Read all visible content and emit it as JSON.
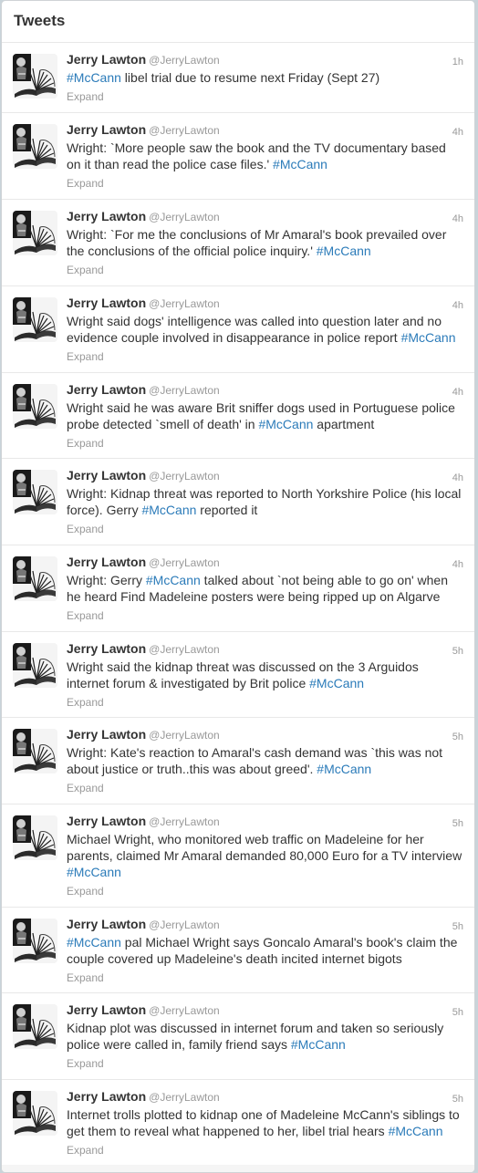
{
  "header": {
    "title": "Tweets"
  },
  "expand_label": "Expand",
  "colors": {
    "hashtag": "#2b7bb9",
    "name": "#333333",
    "meta": "#999999"
  },
  "tweets": [
    {
      "name": "Jerry Lawton",
      "handle": "@JerryLawton",
      "time": "1h",
      "segments": [
        {
          "tag": "#McCann"
        },
        {
          "t": " libel trial due to resume next Friday (Sept 27)"
        }
      ]
    },
    {
      "name": "Jerry Lawton",
      "handle": "@JerryLawton",
      "time": "4h",
      "segments": [
        {
          "t": "Wright: `More people saw the book and the TV documentary based on it than read the police case files.' "
        },
        {
          "tag": "#McCann"
        }
      ]
    },
    {
      "name": "Jerry Lawton",
      "handle": "@JerryLawton",
      "time": "4h",
      "segments": [
        {
          "t": "Wright: `For me the conclusions of Mr Amaral's book prevailed over the conclusions of the official police inquiry.' "
        },
        {
          "tag": "#McCann"
        }
      ]
    },
    {
      "name": "Jerry Lawton",
      "handle": "@JerryLawton",
      "time": "4h",
      "segments": [
        {
          "t": "Wright said dogs' intelligence was called into question later and no evidence couple involved in disappearance in police report "
        },
        {
          "tag": "#McCann"
        }
      ]
    },
    {
      "name": "Jerry Lawton",
      "handle": "@JerryLawton",
      "time": "4h",
      "segments": [
        {
          "t": "Wright said he was aware Brit sniffer dogs used in Portuguese police probe detected `smell of death' in "
        },
        {
          "tag": "#McCann"
        },
        {
          "t": " apartment"
        }
      ]
    },
    {
      "name": "Jerry Lawton",
      "handle": "@JerryLawton",
      "time": "4h",
      "segments": [
        {
          "t": "Wright: Kidnap threat was reported to North Yorkshire Police (his local force). Gerry "
        },
        {
          "tag": "#McCann"
        },
        {
          "t": " reported it"
        }
      ]
    },
    {
      "name": "Jerry Lawton",
      "handle": "@JerryLawton",
      "time": "4h",
      "segments": [
        {
          "t": "Wright: Gerry "
        },
        {
          "tag": "#McCann"
        },
        {
          "t": " talked about `not being able to go on' when he heard Find Madeleine posters were being ripped up on Algarve"
        }
      ]
    },
    {
      "name": "Jerry Lawton",
      "handle": "@JerryLawton",
      "time": "5h",
      "segments": [
        {
          "t": "Wright said the kidnap threat was discussed on the 3 Arguidos internet forum & investigated by Brit police "
        },
        {
          "tag": "#McCann"
        }
      ]
    },
    {
      "name": "Jerry Lawton",
      "handle": "@JerryLawton",
      "time": "5h",
      "segments": [
        {
          "t": "Wright: Kate's reaction to Amaral's cash demand was `this was not about justice or truth..this was about greed'. "
        },
        {
          "tag": "#McCann"
        }
      ]
    },
    {
      "name": "Jerry Lawton",
      "handle": "@JerryLawton",
      "time": "5h",
      "segments": [
        {
          "t": "Michael Wright, who monitored web traffic on Madeleine for her parents, claimed Mr Amaral demanded 80,000 Euro for a TV interview "
        },
        {
          "tag": "#McCann"
        }
      ]
    },
    {
      "name": "Jerry Lawton",
      "handle": "@JerryLawton",
      "time": "5h",
      "segments": [
        {
          "tag": "#McCann"
        },
        {
          "t": " pal Michael Wright says Goncalo Amaral's book's claim the couple covered up Madeleine's death incited internet bigots"
        }
      ]
    },
    {
      "name": "Jerry Lawton",
      "handle": "@JerryLawton",
      "time": "5h",
      "segments": [
        {
          "t": "Kidnap plot was discussed in internet forum and taken so seriously police were called in, family friend says "
        },
        {
          "tag": "#McCann"
        }
      ]
    },
    {
      "name": "Jerry Lawton",
      "handle": "@JerryLawton",
      "time": "5h",
      "segments": [
        {
          "t": "Internet trolls plotted to kidnap one of Madeleine McCann's siblings to get them to reveal what happened to her, libel trial hears "
        },
        {
          "tag": "#McCann"
        }
      ]
    }
  ]
}
